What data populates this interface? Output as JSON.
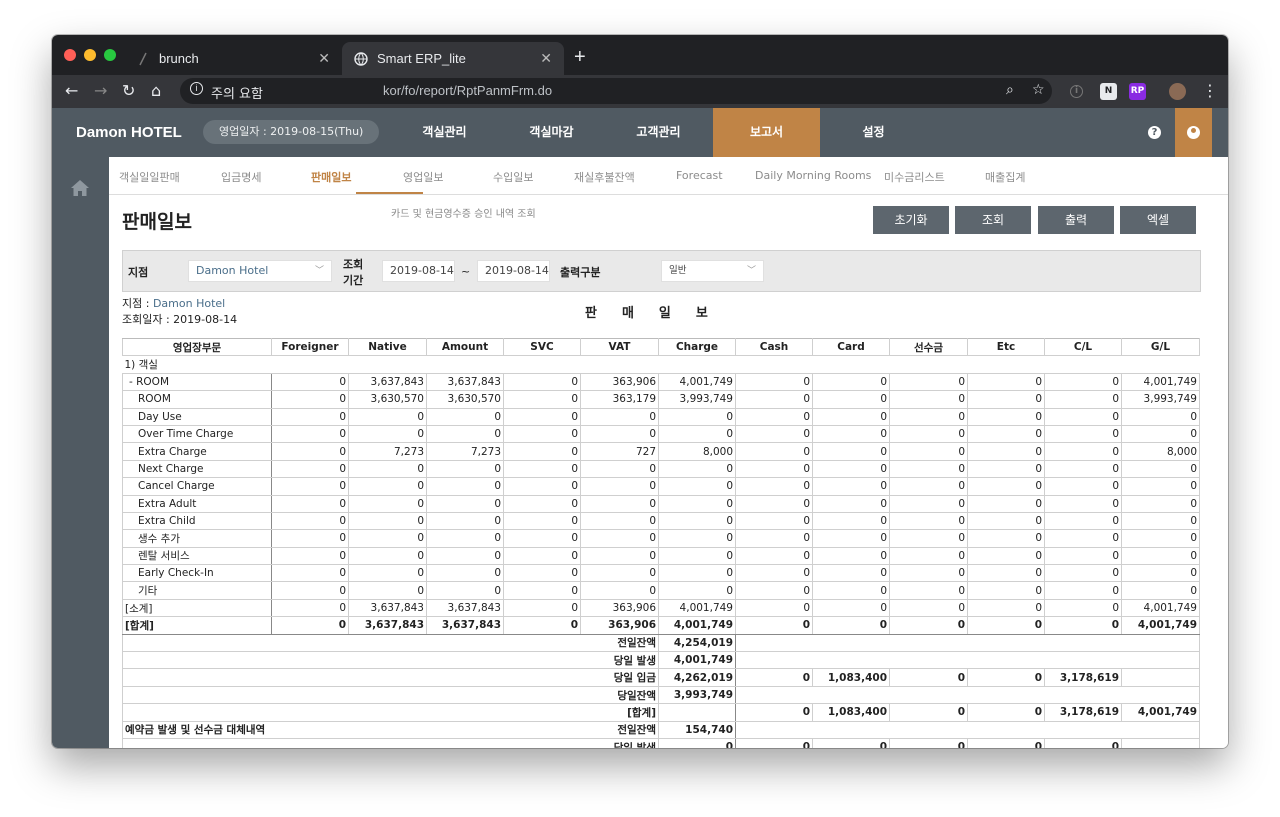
{
  "browser": {
    "tabs": [
      {
        "title": "brunch"
      },
      {
        "title": "Smart ERP_lite"
      }
    ],
    "security_warning": "주의 요함",
    "url": "kor/fo/report/RptPanmFrm.do"
  },
  "app": {
    "brand": "Damon HOTEL",
    "business_date": "영업일자 : 2019-08-15(Thu)",
    "main_menu": [
      "객실관리",
      "객실마감",
      "고객관리",
      "보고서",
      "설정"
    ],
    "active_main_menu": "보고서",
    "sub_menu": [
      "객실일일판매",
      "입금명세",
      "판매일보",
      "영업일보",
      "수입일보",
      "재실후불잔액",
      "Forecast",
      "Daily Morning Rooms",
      "미수금리스트",
      "매출집계"
    ],
    "active_sub_menu": "판매일보"
  },
  "page": {
    "title": "판매일보",
    "description": "카드 및 현금영수증 승인 내역 조회",
    "buttons": {
      "reset": "초기화",
      "search": "조회",
      "print": "출력",
      "excel": "엑셀"
    }
  },
  "filter": {
    "branch_label": "지점",
    "branch_value": "Damon Hotel",
    "period_label_1": "조회",
    "period_label_2": "기간",
    "date_from": "2019-08-14",
    "date_sep": "~",
    "date_to": "2019-08-14",
    "output_label": "출력구분",
    "output_value": "일반"
  },
  "report": {
    "branch_label": "지점",
    "branch_value": "Damon Hotel",
    "date_label": "조회일자 : 2019-08-14",
    "title": "판매일보",
    "columns": [
      "영업장부문",
      "Foreigner",
      "Native",
      "Amount",
      "SVC",
      "VAT",
      "Charge",
      "Cash",
      "Card",
      "선수금",
      "Etc",
      "C/L",
      "G/L"
    ],
    "section": "1) 객실",
    "rows": [
      {
        "label": "- ROOM",
        "values": [
          "0",
          "3,637,843",
          "3,637,843",
          "0",
          "363,906",
          "4,001,749",
          "0",
          "0",
          "0",
          "0",
          "0",
          "4,001,749"
        ]
      },
      {
        "label": "ROOM",
        "values": [
          "0",
          "3,630,570",
          "3,630,570",
          "0",
          "363,179",
          "3,993,749",
          "0",
          "0",
          "0",
          "0",
          "0",
          "3,993,749"
        ]
      },
      {
        "label": "Day Use",
        "values": [
          "0",
          "0",
          "0",
          "0",
          "0",
          "0",
          "0",
          "0",
          "0",
          "0",
          "0",
          "0"
        ]
      },
      {
        "label": "Over Time Charge",
        "values": [
          "0",
          "0",
          "0",
          "0",
          "0",
          "0",
          "0",
          "0",
          "0",
          "0",
          "0",
          "0"
        ]
      },
      {
        "label": "Extra Charge",
        "values": [
          "0",
          "7,273",
          "7,273",
          "0",
          "727",
          "8,000",
          "0",
          "0",
          "0",
          "0",
          "0",
          "8,000"
        ]
      },
      {
        "label": "Next Charge",
        "values": [
          "0",
          "0",
          "0",
          "0",
          "0",
          "0",
          "0",
          "0",
          "0",
          "0",
          "0",
          "0"
        ]
      },
      {
        "label": "Cancel Charge",
        "values": [
          "0",
          "0",
          "0",
          "0",
          "0",
          "0",
          "0",
          "0",
          "0",
          "0",
          "0",
          "0"
        ]
      },
      {
        "label": "Extra Adult",
        "values": [
          "0",
          "0",
          "0",
          "0",
          "0",
          "0",
          "0",
          "0",
          "0",
          "0",
          "0",
          "0"
        ]
      },
      {
        "label": "Extra Child",
        "values": [
          "0",
          "0",
          "0",
          "0",
          "0",
          "0",
          "0",
          "0",
          "0",
          "0",
          "0",
          "0"
        ]
      },
      {
        "label": "생수 추가",
        "values": [
          "0",
          "0",
          "0",
          "0",
          "0",
          "0",
          "0",
          "0",
          "0",
          "0",
          "0",
          "0"
        ]
      },
      {
        "label": "렌탈 서비스",
        "values": [
          "0",
          "0",
          "0",
          "0",
          "0",
          "0",
          "0",
          "0",
          "0",
          "0",
          "0",
          "0"
        ]
      },
      {
        "label": "Early Check-In",
        "values": [
          "0",
          "0",
          "0",
          "0",
          "0",
          "0",
          "0",
          "0",
          "0",
          "0",
          "0",
          "0"
        ]
      },
      {
        "label": "기타",
        "values": [
          "0",
          "0",
          "0",
          "0",
          "0",
          "0",
          "0",
          "0",
          "0",
          "0",
          "0",
          "0"
        ]
      },
      {
        "label": "[소계]",
        "values": [
          "0",
          "3,637,843",
          "3,637,843",
          "0",
          "363,906",
          "4,001,749",
          "0",
          "0",
          "0",
          "0",
          "0",
          "4,001,749"
        ]
      }
    ],
    "total_label": "[합계]",
    "total_values": [
      "0",
      "3,637,843",
      "3,637,843",
      "0",
      "363,906",
      "4,001,749",
      "0",
      "0",
      "0",
      "0",
      "0",
      "4,001,749"
    ],
    "summary": [
      {
        "label": "전일잔액",
        "charge": "4,254,019",
        "tail": []
      },
      {
        "label": "당일 발생",
        "charge": "4,001,749",
        "tail": []
      },
      {
        "label": "당일 입금",
        "charge": "4,262,019",
        "tail": [
          "0",
          "1,083,400",
          "0",
          "0",
          "3,178,619",
          ""
        ]
      },
      {
        "label": "당일잔액",
        "charge": "3,993,749",
        "tail": []
      },
      {
        "label": "[합계]",
        "charge": "",
        "tail": [
          "0",
          "1,083,400",
          "0",
          "0",
          "3,178,619",
          "4,001,749"
        ]
      }
    ],
    "deposit_section": "예약금 발생 및 선수금 대체내역",
    "deposit_rows": [
      {
        "label": "전일잔액",
        "charge": "154,740",
        "tail": []
      },
      {
        "label": "당일 발생",
        "charge": "0",
        "tail": [
          "0",
          "0",
          "0",
          "0",
          "0",
          ""
        ]
      }
    ]
  },
  "colors": {
    "nav_bg": "#505a62",
    "accent": "#c08446",
    "button_bg": "#5d666e"
  }
}
